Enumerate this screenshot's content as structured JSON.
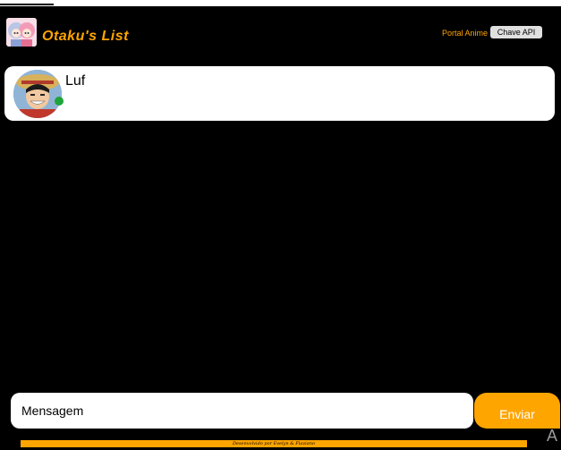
{
  "header": {
    "brand": "Otaku's List",
    "portal_link": "Portal Anime",
    "api_button": "Chave API"
  },
  "chat": {
    "contact_name": "Luf",
    "status": "online"
  },
  "composer": {
    "placeholder": "Mensagem",
    "send_label": "Enviar"
  },
  "footer": {
    "credit": "Desenvolvido por Evelyn & Flaviano"
  },
  "watermark": "A",
  "colors": {
    "accent": "#ffa500",
    "background": "#000000",
    "status_online": "#1fa33a"
  },
  "icons": {
    "logo": "anime-girls-logo",
    "avatar": "luffy-avatar"
  }
}
